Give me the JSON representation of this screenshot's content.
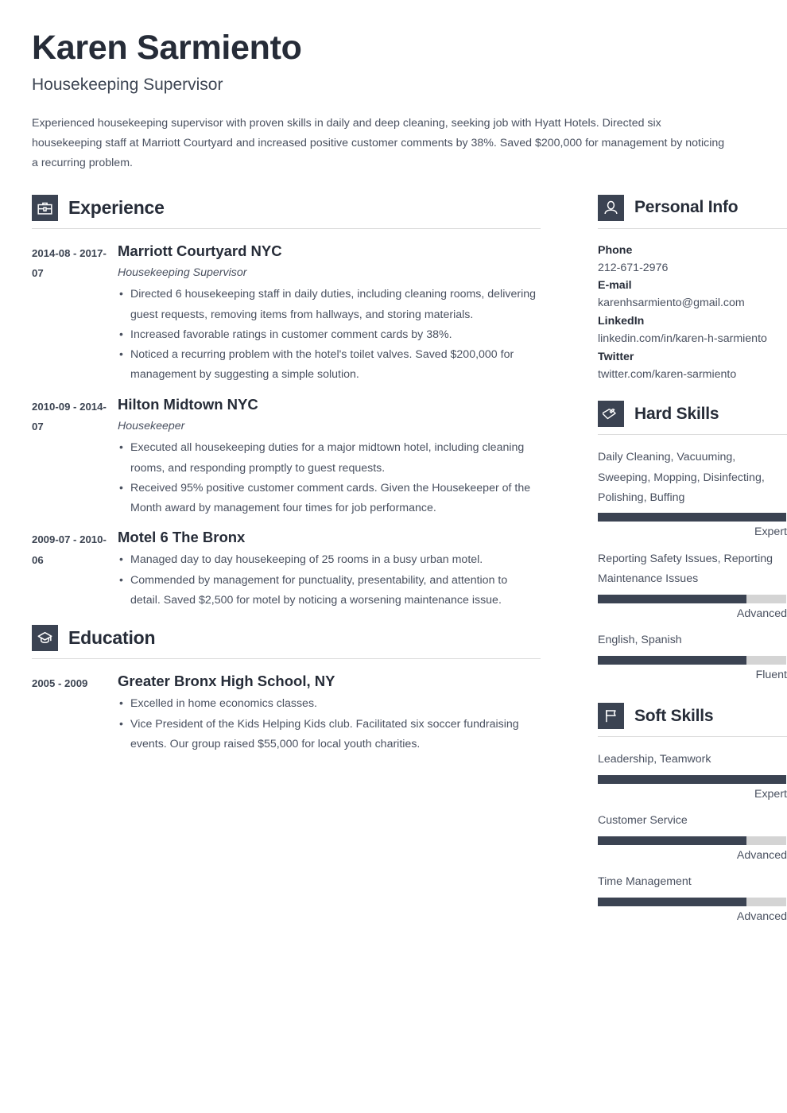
{
  "header": {
    "full_name": "Karen Sarmiento",
    "job_title": "Housekeeping Supervisor",
    "summary": "Experienced housekeeping supervisor with proven skills in daily and deep cleaning, seeking job with Hyatt Hotels. Directed six housekeeping staff at Marriott Courtyard and increased positive customer comments by 38%. Saved $200,000 for management by noticing a recurring problem."
  },
  "sections": {
    "experience": {
      "title": "Experience",
      "icon": "briefcase-icon",
      "entries": [
        {
          "dates": "2014-08 - 2017-07",
          "organization": "Marriott Courtyard NYC",
          "role": "Housekeeping Supervisor",
          "bullets": [
            "Directed 6 housekeeping staff in daily duties, including cleaning rooms, delivering guest requests, removing items from hallways, and storing materials.",
            "Increased favorable ratings in customer comment cards by 38%.",
            "Noticed a recurring problem with the hotel's toilet valves. Saved $200,000 for management by suggesting a simple solution."
          ]
        },
        {
          "dates": "2010-09 - 2014-07",
          "organization": "Hilton Midtown NYC",
          "role": "Housekeeper",
          "bullets": [
            "Executed all housekeeping duties for a major midtown hotel, including cleaning rooms, and responding promptly to guest requests.",
            "Received 95% positive customer comment cards. Given the Housekeeper of the Month award by management four times for job performance."
          ]
        },
        {
          "dates": "2009-07 - 2010-06",
          "organization": "Motel 6 The Bronx",
          "role": "",
          "bullets": [
            "Managed day to day housekeeping of 25 rooms in a busy urban motel.",
            "Commended by management for punctuality, presentability, and attention to detail. Saved $2,500 for motel by noticing a worsening maintenance issue."
          ]
        }
      ]
    },
    "education": {
      "title": "Education",
      "icon": "graduation-cap-icon",
      "entries": [
        {
          "dates": "2005 - 2009",
          "organization": "Greater Bronx High School, NY",
          "role": "",
          "bullets": [
            "Excelled in home economics classes.",
            "Vice President of the Kids Helping Kids club. Facilitated six soccer fundraising events. Our group raised $55,000 for local youth charities."
          ]
        }
      ]
    },
    "personal_info": {
      "title": "Personal Info",
      "icon": "person-icon",
      "fields": [
        {
          "label": "Phone",
          "value": "212-671-2976"
        },
        {
          "label": "E-mail",
          "value": "karenhsarmiento@gmail.com"
        },
        {
          "label": "LinkedIn",
          "value": "linkedin.com/in/karen-h-sarmiento"
        },
        {
          "label": "Twitter",
          "value": "twitter.com/karen-sarmiento"
        }
      ]
    },
    "hard_skills": {
      "title": "Hard Skills",
      "icon": "puzzle-piece-icon",
      "skills": [
        {
          "name": "Daily Cleaning, Vacuuming, Sweeping, Mopping, Disinfecting, Polishing, Buffing",
          "level": "Expert",
          "percent": 100
        },
        {
          "name": "Reporting Safety Issues, Reporting Maintenance Issues",
          "level": "Advanced",
          "percent": 79
        },
        {
          "name": "English, Spanish",
          "level": "Fluent",
          "percent": 79
        }
      ]
    },
    "soft_skills": {
      "title": "Soft Skills",
      "icon": "flag-icon",
      "skills": [
        {
          "name": "Leadership, Teamwork",
          "level": "Expert",
          "percent": 100
        },
        {
          "name": "Customer Service",
          "level": "Advanced",
          "percent": 79
        },
        {
          "name": "Time Management",
          "level": "Advanced",
          "percent": 79
        }
      ]
    }
  },
  "colors": {
    "accent_dark": "#3b4352",
    "heading": "#262c38",
    "text": "#4a5160",
    "bar_track": "#d4d4d4",
    "rule": "#dcdcdc"
  }
}
